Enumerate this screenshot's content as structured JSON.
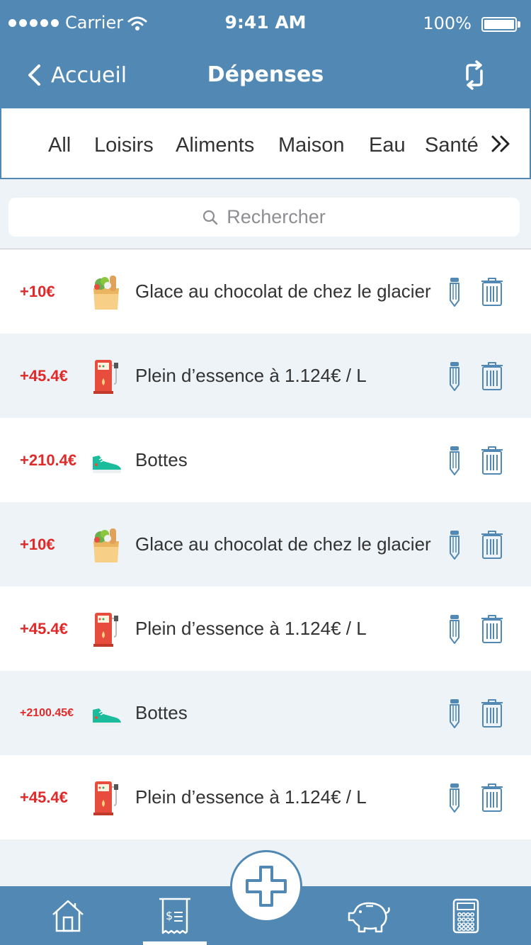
{
  "status_bar": {
    "carrier": "Carrier",
    "time": "9:41 AM",
    "battery": "100%"
  },
  "nav": {
    "back_label": "Accueil",
    "title": "Dépenses",
    "sync_icon": "sync-icon"
  },
  "categories": {
    "items": [
      "All",
      "Loisirs",
      "Aliments",
      "Maison",
      "Eau",
      "Santé"
    ],
    "more_icon": "double-chevron-right-icon"
  },
  "search": {
    "placeholder": "Rechercher"
  },
  "expenses": [
    {
      "amount": "+10€",
      "icon": "grocery-bag-icon",
      "label": "Glace au chocolat de chez le glacier"
    },
    {
      "amount": "+45.4€",
      "icon": "fuel-pump-icon",
      "label": "Plein d’essence à 1.124€ / L"
    },
    {
      "amount": "+210.4€",
      "icon": "sneaker-icon",
      "label": "Bottes"
    },
    {
      "amount": "+10€",
      "icon": "grocery-bag-icon",
      "label": "Glace au chocolat de chez le glacier"
    },
    {
      "amount": "+45.4€",
      "icon": "fuel-pump-icon",
      "label": "Plein d’essence à 1.124€ / L"
    },
    {
      "amount": "+2100.45€",
      "icon": "sneaker-icon",
      "label": "Bottes"
    },
    {
      "amount": "+45.4€",
      "icon": "fuel-pump-icon",
      "label": "Plein d’essence à 1.124€ / L"
    }
  ],
  "tabbar": {
    "tabs": [
      "home-icon",
      "receipt-icon",
      "piggy-bank-icon",
      "calculator-icon"
    ],
    "active": "receipt-icon",
    "fab_icon": "plus-icon"
  },
  "colors": {
    "primary": "#5189b4",
    "amount": "#e02a2a",
    "row_alt": "#eef3f7"
  }
}
